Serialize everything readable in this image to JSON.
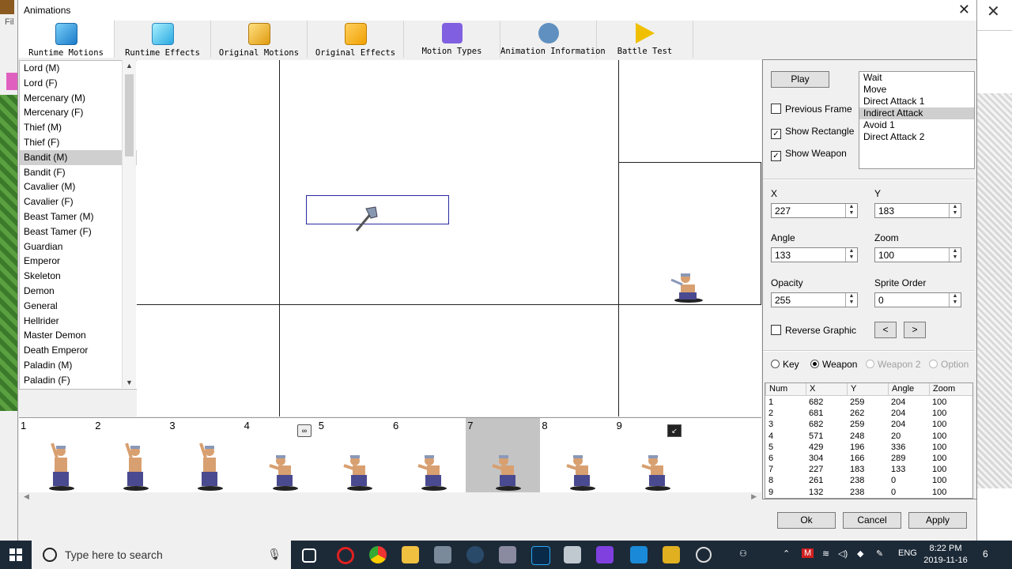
{
  "window": {
    "title": "Animations",
    "close": "✕"
  },
  "background_app": {
    "menu_file": "Fil"
  },
  "toolbar": [
    {
      "label": "Runtime Motions",
      "icon": "runtime-motions-icon",
      "color": "#2a8ad8"
    },
    {
      "label": "Runtime Effects",
      "icon": "runtime-effects-icon",
      "color": "#3ab0e8"
    },
    {
      "label": "Original Motions",
      "icon": "original-motions-icon",
      "color": "#e0a020"
    },
    {
      "label": "Original Effects",
      "icon": "original-effects-icon",
      "color": "#f0b000"
    },
    {
      "label": "Motion Types",
      "icon": "motion-types-icon",
      "color": "#8060e0"
    },
    {
      "label": "Animation Information",
      "icon": "animation-information-icon",
      "color": "#6090c0"
    },
    {
      "label": "Battle Test",
      "icon": "battle-test-icon",
      "color": "#f0c000"
    }
  ],
  "classes": [
    "Lord (M)",
    "Lord (F)",
    "Mercenary (M)",
    "Mercenary (F)",
    "Thief (M)",
    "Thief (F)",
    "Bandit (M)",
    "Bandit (F)",
    "Cavalier (M)",
    "Cavalier (F)",
    "Beast Tamer (M)",
    "Beast Tamer (F)",
    "Guardian",
    "Emperor",
    "Skeleton",
    "Demon",
    "General",
    "Hellrider",
    "Master Demon",
    "Death Emperor",
    "Paladin (M)",
    "Paladin (F)"
  ],
  "selected_class": "Bandit (M)",
  "controls": {
    "play": "Play",
    "previous_frame": "Previous Frame",
    "show_rectangle": "Show Rectangle",
    "show_weapon": "Show Weapon",
    "previous_frame_checked": false,
    "show_rectangle_checked": true,
    "show_weapon_checked": true
  },
  "motions": [
    "Wait",
    "Move",
    "Direct Attack 1",
    "Indirect Attack",
    "Avoid 1",
    "Direct Attack 2"
  ],
  "selected_motion": "Indirect Attack",
  "fields": {
    "x_label": "X",
    "x": "227",
    "y_label": "Y",
    "y": "183",
    "angle_label": "Angle",
    "angle": "133",
    "zoom_label": "Zoom",
    "zoom": "100",
    "opacity_label": "Opacity",
    "opacity": "255",
    "sprite_order_label": "Sprite Order",
    "sprite_order": "0"
  },
  "reverse_graphic": "Reverse Graphic",
  "nav": {
    "prev": "<",
    "next": ">"
  },
  "radios": [
    {
      "label": "Key",
      "checked": false,
      "disabled": false
    },
    {
      "label": "Weapon",
      "checked": true,
      "disabled": false
    },
    {
      "label": "Weapon 2",
      "checked": false,
      "disabled": true
    },
    {
      "label": "Option",
      "checked": false,
      "disabled": true
    }
  ],
  "table": {
    "columns": [
      "Num",
      "X",
      "Y",
      "Angle",
      "Zoom"
    ],
    "rows": [
      [
        "1",
        "682",
        "259",
        "204",
        "100"
      ],
      [
        "2",
        "681",
        "262",
        "204",
        "100"
      ],
      [
        "3",
        "682",
        "259",
        "204",
        "100"
      ],
      [
        "4",
        "571",
        "248",
        "20",
        "100"
      ],
      [
        "5",
        "429",
        "196",
        "336",
        "100"
      ],
      [
        "6",
        "304",
        "166",
        "289",
        "100"
      ],
      [
        "7",
        "227",
        "183",
        "133",
        "100"
      ],
      [
        "8",
        "261",
        "238",
        "0",
        "100"
      ],
      [
        "9",
        "132",
        "238",
        "0",
        "100"
      ]
    ]
  },
  "frames": [
    "1",
    "2",
    "3",
    "4",
    "5",
    "6",
    "7",
    "8",
    "9"
  ],
  "selected_frame": "7",
  "buttons": {
    "ok": "Ok",
    "cancel": "Cancel",
    "apply": "Apply"
  },
  "taskbar": {
    "search_placeholder": "Type here to search",
    "lang": "ENG",
    "time": "8:22 PM",
    "date": "2019-11-16",
    "notifications": "6"
  }
}
